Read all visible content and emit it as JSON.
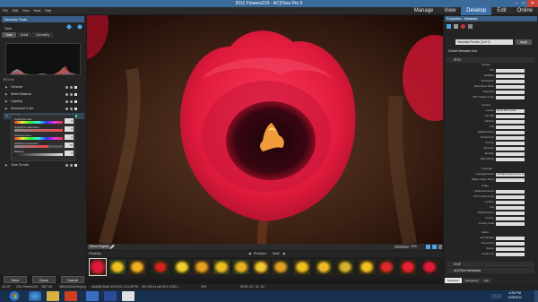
{
  "window": {
    "title": "2011 Flowers219 - ACDSee Pro 5"
  },
  "menu": [
    "File",
    "Edit",
    "View",
    "Tools",
    "Help"
  ],
  "modes": [
    {
      "label": "Manage",
      "active": false
    },
    {
      "label": "View",
      "active": false
    },
    {
      "label": "Develop",
      "active": true
    },
    {
      "label": "Edit",
      "active": false
    },
    {
      "label": "Online",
      "active": false
    }
  ],
  "left_panel": {
    "title": "Develop Tools",
    "section": "Tune",
    "tabs": [
      "Tune",
      "Detail",
      "Geometry"
    ],
    "exposure": "EV 0 %",
    "rows": [
      "General",
      "White Balance",
      "Lighting",
      "Advanced Color",
      "Split Tone"
    ],
    "split_tone": [
      {
        "label": "Highlights Hue",
        "value": "0"
      },
      {
        "label": "Highlights Saturation",
        "value": "0"
      },
      {
        "label": "Shadows Hue",
        "value": "0"
      },
      {
        "label": "Shadows Saturation",
        "value": "70"
      },
      {
        "label": "Balance",
        "value": "0"
      }
    ],
    "tone_curves": "Tone Curves",
    "buttons": [
      "Save",
      "Done",
      "Cancel"
    ]
  },
  "image_toolbar": {
    "show_original": "Show Original",
    "zoom": "23%"
  },
  "filmstrip": {
    "label": "Filmstrip",
    "previous": "Previous",
    "next": "Next"
  },
  "status_bar": {
    "index": "41/137",
    "file": "2011 Flowers219",
    "size": "3647 KB",
    "dimensions": "3584x2240x24b jpeg",
    "modified": "Modified Date: 5/11/2011 3:31:26 PM",
    "exposure": "ISO 100  44 mm  f/5.3  1/200 s",
    "zoom": "23%",
    "pixel": "(RGB: 107, 34, 15)"
  },
  "right_panel": {
    "title": "Properties - Metadata",
    "preset": "Metadata Presets (Ctrl+0)",
    "apply": "Apply",
    "view": "Default Metadata View",
    "groups": [
      "IPTC",
      "EXIF",
      "ACDSee Metadata"
    ],
    "subheads": [
      "Content",
      "Contact",
      "Copyright",
      "Image",
      "Status"
    ],
    "fields": [
      {
        "label": "Title",
        "value": ""
      },
      {
        "label": "Headline",
        "value": ""
      },
      {
        "label": "Description",
        "value": ""
      },
      {
        "label": "Description Writer",
        "value": ""
      },
      {
        "label": "Keywords",
        "value": ""
      },
      {
        "label": "IPTC Subject Code",
        "value": ""
      },
      {
        "label": "Creator",
        "value": "Jamie Allen Larson"
      },
      {
        "label": "Job Title",
        "value": ""
      },
      {
        "label": "Address",
        "value": ""
      },
      {
        "label": "City",
        "value": ""
      },
      {
        "label": "State/Province",
        "value": ""
      },
      {
        "label": "Postal Code",
        "value": ""
      },
      {
        "label": "Country",
        "value": ""
      },
      {
        "label": "Phone(s)",
        "value": ""
      },
      {
        "label": "Email(s)",
        "value": ""
      },
      {
        "label": "Web URL(s)",
        "value": ""
      },
      {
        "label": "Copyright Notice",
        "value": "All Rights Reserved (C) 2011"
      },
      {
        "label": "Rights Usage Terms",
        "value": ""
      },
      {
        "label": "Intellectual Genre",
        "value": ""
      },
      {
        "label": "IPTC Scene Code",
        "value": ""
      },
      {
        "label": "Location",
        "value": ""
      },
      {
        "label": "City",
        "value": ""
      },
      {
        "label": "State/Province",
        "value": ""
      },
      {
        "label": "Country",
        "value": ""
      },
      {
        "label": "Country Code",
        "value": ""
      },
      {
        "label": "Job Identifier",
        "value": ""
      },
      {
        "label": "Instructions",
        "value": ""
      },
      {
        "label": "Source",
        "value": ""
      },
      {
        "label": "Credit Line",
        "value": ""
      }
    ],
    "tabs": [
      {
        "label": "Metadata",
        "active": true
      },
      {
        "label": "Categories",
        "active": false
      },
      {
        "label": "File",
        "active": false
      }
    ]
  },
  "taskbar": {
    "time": "4:26 PM",
    "date": "12/5/2011"
  },
  "colors": {
    "accent": "#3d6fa8",
    "flower": "#e01a3c",
    "panel": "#242424"
  }
}
